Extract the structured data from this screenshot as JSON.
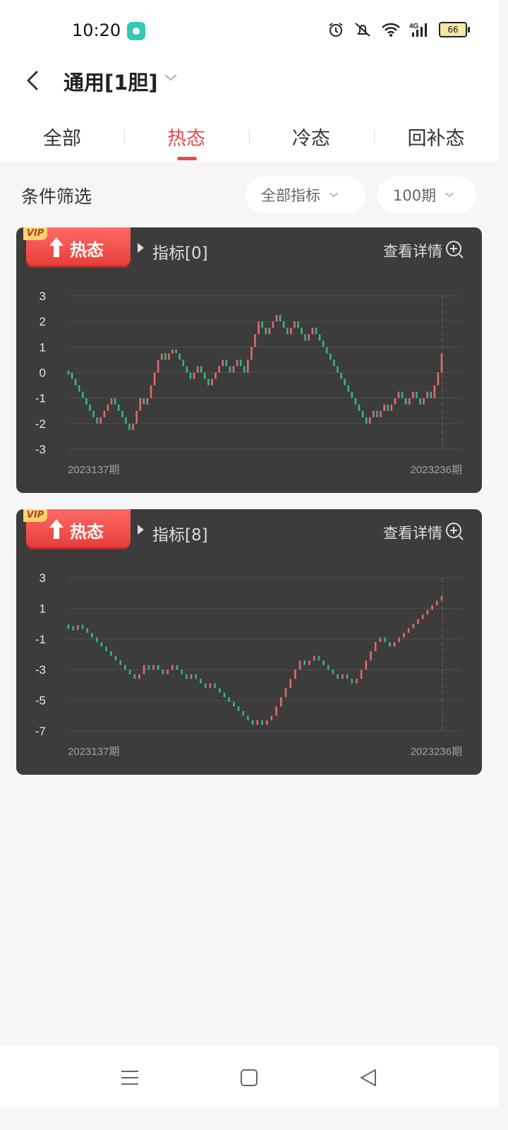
{
  "status": {
    "time": "10:20",
    "battery": "66",
    "network": "4G"
  },
  "header": {
    "title": "通用[1胆]"
  },
  "tabs": [
    {
      "label": "全部",
      "active": false
    },
    {
      "label": "热态",
      "active": true
    },
    {
      "label": "冷态",
      "active": false
    },
    {
      "label": "回补态",
      "active": false
    }
  ],
  "filter": {
    "label": "条件筛选",
    "indicator_select": "全部指标",
    "period_select": "100期"
  },
  "colors": {
    "accent": "#e94b4b",
    "up": "#e8686a",
    "down": "#2fb889",
    "card_bg": "#3c3c3c"
  },
  "cards": [
    {
      "vip": "VIP",
      "badge": "热态",
      "indicator": "指标[0]",
      "detail": "查看详情",
      "chart_data": {
        "type": "line",
        "title": "",
        "xlabel": "",
        "ylabel": "",
        "x_start_label": "2023137期",
        "x_end_label": "2023236期",
        "yticks": [
          3,
          2,
          1,
          0,
          -1,
          -2,
          -3
        ],
        "ylim": [
          -3,
          3
        ],
        "grid": true,
        "values": [
          0,
          -0.25,
          -0.5,
          -0.75,
          -1,
          -1.25,
          -1.5,
          -1.75,
          -2,
          -1.75,
          -1.5,
          -1.25,
          -1,
          -1.25,
          -1.5,
          -1.75,
          -2,
          -2.25,
          -2,
          -1.5,
          -1,
          -1.25,
          -1,
          -0.5,
          0,
          0.5,
          0.75,
          0.5,
          0.75,
          0.9,
          0.75,
          0.5,
          0.25,
          0,
          -0.25,
          0,
          0.25,
          0,
          -0.25,
          -0.5,
          -0.25,
          0,
          0.25,
          0.5,
          0.25,
          0,
          0.25,
          0.5,
          0.25,
          0,
          0.5,
          1,
          1.5,
          2,
          1.75,
          1.5,
          1.75,
          2,
          2.25,
          2,
          1.75,
          1.5,
          1.75,
          2,
          1.75,
          1.5,
          1.25,
          1.5,
          1.75,
          1.5,
          1.25,
          1,
          0.75,
          0.5,
          0.25,
          0,
          -0.25,
          -0.5,
          -0.75,
          -1,
          -1.25,
          -1.5,
          -1.75,
          -2,
          -1.75,
          -1.5,
          -1.75,
          -1.5,
          -1.25,
          -1.5,
          -1.25,
          -1,
          -0.75,
          -1,
          -1.25,
          -1,
          -0.75,
          -1,
          -1.25,
          -1,
          -0.75,
          -1,
          -0.5,
          0,
          0.75
        ]
      }
    },
    {
      "vip": "VIP",
      "badge": "热态",
      "indicator": "指标[8]",
      "detail": "查看详情",
      "chart_data": {
        "type": "line",
        "title": "",
        "xlabel": "",
        "ylabel": "",
        "x_start_label": "2023137期",
        "x_end_label": "2023236期",
        "yticks": [
          3,
          1,
          -1,
          -3,
          -5,
          -7
        ],
        "ylim": [
          -7,
          3
        ],
        "grid": true,
        "values": [
          -0.2,
          -0.4,
          -0.1,
          -0.3,
          -0.6,
          -0.9,
          -1.2,
          -1.5,
          -1.8,
          -2.1,
          -2.4,
          -2.7,
          -3,
          -3.3,
          -3.6,
          -3.3,
          -2.7,
          -3,
          -2.7,
          -3,
          -3.3,
          -3,
          -2.7,
          -3,
          -3.3,
          -3.6,
          -3.3,
          -3.6,
          -3.9,
          -4.2,
          -3.9,
          -4.2,
          -4.5,
          -4.8,
          -5.1,
          -5.4,
          -5.7,
          -6,
          -6.3,
          -6.6,
          -6.3,
          -6.6,
          -6.3,
          -6,
          -5.4,
          -4.8,
          -4.2,
          -3.6,
          -3,
          -2.4,
          -2.7,
          -2.4,
          -2.1,
          -2.4,
          -2.7,
          -3,
          -3.3,
          -3.6,
          -3.3,
          -3.6,
          -3.9,
          -3.6,
          -3,
          -2.4,
          -1.8,
          -1.2,
          -0.9,
          -1.2,
          -1.5,
          -1.2,
          -0.9,
          -0.6,
          -0.3,
          0,
          0.3,
          0.6,
          0.9,
          1.2,
          1.5,
          1.8
        ]
      }
    }
  ],
  "navbar": {
    "items": [
      "menu",
      "home",
      "back"
    ]
  }
}
